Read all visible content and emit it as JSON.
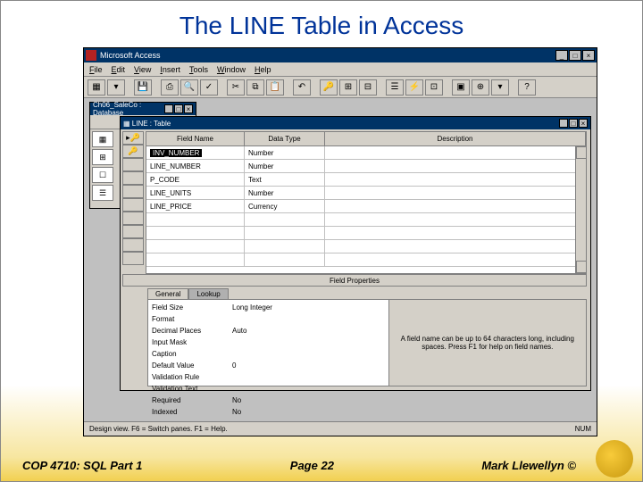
{
  "slide": {
    "title": "The LINE Table in Access"
  },
  "app": {
    "title": "Microsoft Access",
    "menu": {
      "file": "File",
      "edit": "Edit",
      "view": "View",
      "insert": "Insert",
      "tools": "Tools",
      "window": "Window",
      "help": "Help"
    }
  },
  "dbWindow": {
    "title": "Ch06_SaleCo : Database"
  },
  "tableWindow": {
    "title": "LINE : Table",
    "headers": {
      "fieldName": "Field Name",
      "dataType": "Data Type",
      "description": "Description"
    },
    "rows": [
      {
        "key": true,
        "name": "INV_NUMBER",
        "type": "Number",
        "selected": true,
        "current": true
      },
      {
        "key": true,
        "name": "LINE_NUMBER",
        "type": "Number"
      },
      {
        "key": false,
        "name": "P_CODE",
        "type": "Text"
      },
      {
        "key": false,
        "name": "LINE_UNITS",
        "type": "Number"
      },
      {
        "key": false,
        "name": "LINE_PRICE",
        "type": "Currency"
      }
    ],
    "propBar": "Field Properties",
    "tabs": {
      "general": "General",
      "lookup": "Lookup"
    },
    "props": [
      {
        "label": "Field Size",
        "value": "Long Integer"
      },
      {
        "label": "Format",
        "value": ""
      },
      {
        "label": "Decimal Places",
        "value": "Auto"
      },
      {
        "label": "Input Mask",
        "value": ""
      },
      {
        "label": "Caption",
        "value": ""
      },
      {
        "label": "Default Value",
        "value": "0"
      },
      {
        "label": "Validation Rule",
        "value": ""
      },
      {
        "label": "Validation Text",
        "value": ""
      },
      {
        "label": "Required",
        "value": "No"
      },
      {
        "label": "Indexed",
        "value": "No"
      }
    ],
    "help": "A field name can be up to 64 characters long, including spaces. Press F1 for help on field names."
  },
  "status": {
    "left": "Design view.  F6 = Switch panes.  F1 = Help.",
    "right": "NUM"
  },
  "footer": {
    "left": "COP 4710: SQL Part 1",
    "mid": "Page 22",
    "right": "Mark Llewellyn ©"
  }
}
